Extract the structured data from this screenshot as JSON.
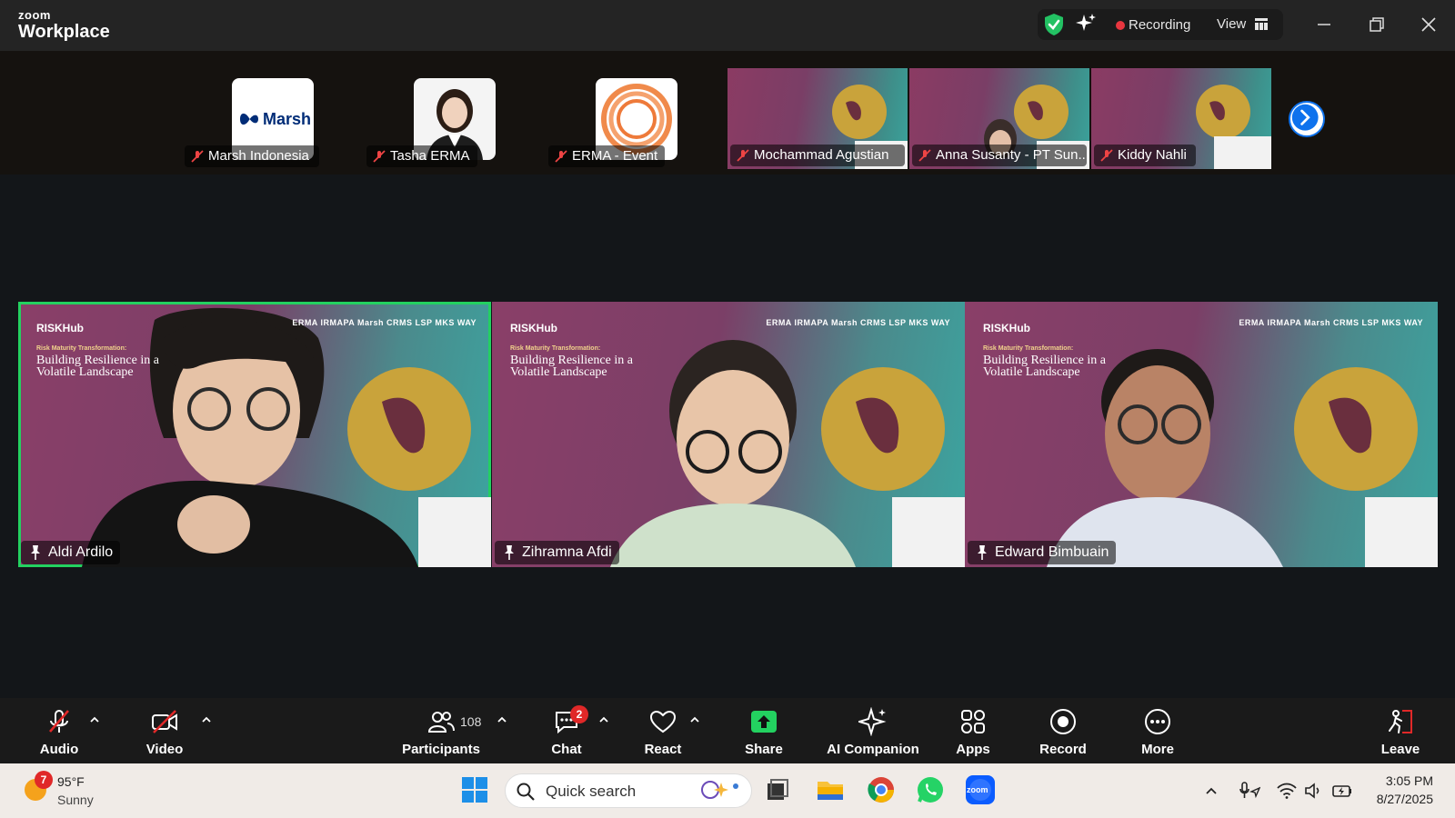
{
  "app": {
    "brand_small": "zoom",
    "brand_large": "Workplace"
  },
  "titlebar": {
    "recording_label": "Recording",
    "view_label": "View"
  },
  "thumbnails": [
    {
      "name": "Marsh Indonesia",
      "avatar_text": "Marsh"
    },
    {
      "name": "Tasha ERMA"
    },
    {
      "name": "ERMA - Event"
    },
    {
      "name": "Mochammad Agustian"
    },
    {
      "name": "Anna Susanty - PT Sun..."
    },
    {
      "name": "Kiddy Nahli"
    }
  ],
  "slide": {
    "brand": "RISKHub",
    "subtitle": "Risk Maturity Transformation:",
    "title": "Building Resilience in a Volatile Landscape",
    "partner_logos": "ERMA  IRMAPA  Marsh  CRMS  LSP MKS  WAY"
  },
  "tiles": [
    {
      "name": "Aldi Ardilo",
      "active": true
    },
    {
      "name": "Zihramna Afdi"
    },
    {
      "name": "Edward Bimbuain"
    }
  ],
  "controls": {
    "audio": "Audio",
    "video": "Video",
    "participants": "Participants",
    "participants_count": "108",
    "chat": "Chat",
    "chat_badge": "2",
    "react": "React",
    "share": "Share",
    "ai_companion": "AI Companion",
    "apps": "Apps",
    "record": "Record",
    "more": "More",
    "leave": "Leave"
  },
  "taskbar": {
    "weather_badge": "7",
    "temperature": "95°F",
    "condition": "Sunny",
    "search_placeholder": "Quick search",
    "time": "3:05 PM",
    "date": "8/27/2025"
  },
  "colors": {
    "active_speaker": "#23d160",
    "share_green": "#23d160",
    "recording_red": "#e8363f",
    "zoom_blue": "#0e72ed"
  }
}
